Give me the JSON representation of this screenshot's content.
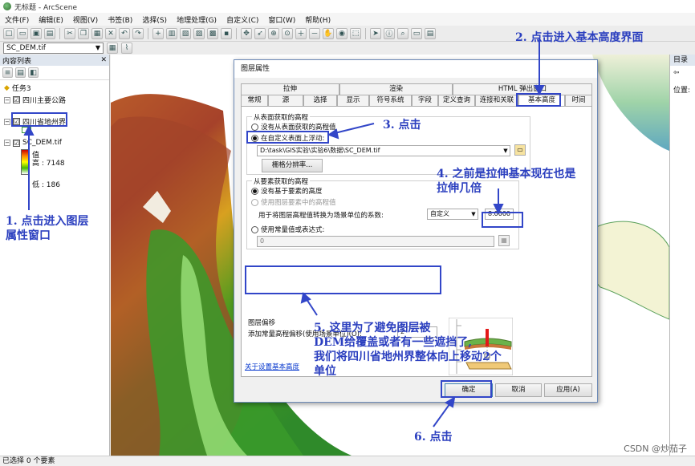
{
  "window": {
    "title": "无标题 - ArcScene"
  },
  "menu": [
    "文件(F)",
    "编辑(E)",
    "视图(V)",
    "书签(B)",
    "选择(S)",
    "地理处理(G)",
    "自定义(C)",
    "窗口(W)",
    "帮助(H)"
  ],
  "toolbar2": {
    "layer_select": "SC_DEM.tif"
  },
  "toc": {
    "header": "内容列表",
    "scene": "任务3",
    "layers": [
      {
        "name": "四川主要公路",
        "checked": "☑"
      },
      {
        "name": "四川省地州界",
        "checked": "☑"
      },
      {
        "name": "SC_DEM.tif",
        "checked": "☑"
      }
    ],
    "legend_label": "值",
    "high": "高 : 7148",
    "low": "低 : 186"
  },
  "catalog": {
    "header": "目录",
    "location_label": "位置:"
  },
  "status": "已选择 0 个要素",
  "dialog": {
    "title": "图层属性",
    "tabs_top": [
      "拉伸",
      "渲染",
      "HTML 弹出窗口"
    ],
    "tabs_bottom": [
      "常规",
      "源",
      "选择",
      "显示",
      "符号系统",
      "字段",
      "定义查询",
      "连接和关联",
      "基本高度",
      "时间"
    ],
    "surface_group": "从表面获取的高程",
    "radio_no_surface": "没有从表面获取的高程值",
    "radio_float": "在自定义表面上浮动:",
    "surface_path": "D:\\task\\GIS实验\\实验6\\数据\\SC_DEM.tif",
    "raster_resolution": "栅格分辨率...",
    "feature_group": "从要素获取的高程",
    "radio_no_feature": "没有基于要素的高度",
    "radio_use_feature": "使用图层要素中的高程值",
    "factor_label": "用于将图层高程值转换为场景单位的系数:",
    "factor_unit": "自定义",
    "factor_value": "8.0000",
    "radio_constant": "使用常量值或表达式:",
    "constant_value": "0",
    "offset_group": "图层偏移",
    "offset_label": "添加常量高程偏移(使用场景单位)(O):",
    "offset_value": "2",
    "about_link": "关于设置基本高度",
    "ok": "确定",
    "cancel": "取消",
    "apply": "应用(A)"
  },
  "annotations": {
    "a1_line1": "1. 点击进入图层",
    "a1_line2": "属性窗口",
    "a2": "2. 点击进入基本高度界面",
    "a3": "3. 点击",
    "a4_line1": "4. 之前是拉伸基本现在也是",
    "a4_line2": "拉伸几倍",
    "a5_line1": "5. 这里为了避免图层被",
    "a5_line2": "DEM给覆盖或者有一些遮挡了,",
    "a5_line3": "我们将四川省地州界整体向上移动2个",
    "a5_line4": "单位",
    "a6": "6. 点击"
  },
  "watermark": "CSDN @炒茄子",
  "colors": {
    "annotation": "#3246c8",
    "link": "#0033cc"
  }
}
